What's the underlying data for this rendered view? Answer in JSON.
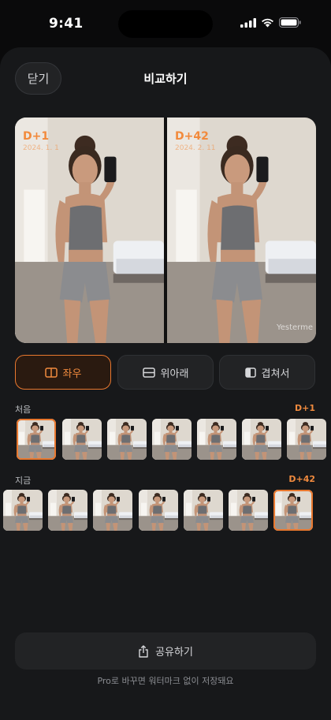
{
  "status": {
    "time": "9:41"
  },
  "header": {
    "close_label": "닫기",
    "title": "비교하기"
  },
  "compare": {
    "left": {
      "day": "D+1",
      "date": "2024. 1. 1"
    },
    "right": {
      "day": "D+42",
      "date": "2024. 2. 11",
      "watermark": "Yesterme"
    }
  },
  "modes": [
    {
      "label": "좌우",
      "icon": "split-horizontal-icon",
      "active": true
    },
    {
      "label": "위아래",
      "icon": "split-vertical-icon",
      "active": false
    },
    {
      "label": "겹쳐서",
      "icon": "overlay-icon",
      "active": false
    }
  ],
  "first_strip": {
    "label": "처음",
    "selected_day": "D+1"
  },
  "now_strip": {
    "label": "지금",
    "selected_day": "D+42"
  },
  "share": {
    "label": "공유하기",
    "icon": "share-icon"
  },
  "footnote": "Pro로 바꾸면 워터마크 없이 저장돼요",
  "colors": {
    "accent": "#e9782f",
    "background": "#17181a",
    "surface": "#222325"
  }
}
